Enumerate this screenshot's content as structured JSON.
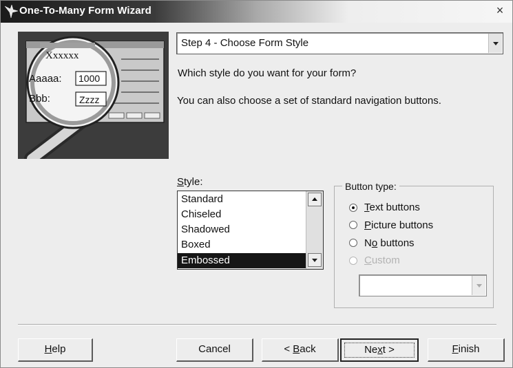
{
  "window": {
    "title": "One-To-Many Form Wizard",
    "close_glyph": "×"
  },
  "illustration": {
    "heading": "Xxxxxx",
    "field1_label": "Aaaaa:",
    "field1_value": "1000",
    "field2_label": "Bbb:",
    "field2_value": "Zzzz"
  },
  "step_select": {
    "value": "Step 4 - Choose Form Style"
  },
  "prompt": {
    "question": "Which style do you want for your form?",
    "hint": "You can also choose a set of standard navigation buttons."
  },
  "style_list": {
    "label": "Style:",
    "label_accel": "S",
    "label_rest": "tyle:",
    "items": [
      "Standard",
      "Chiseled",
      "Shadowed",
      "Boxed",
      "Embossed"
    ],
    "selected": "Embossed"
  },
  "button_type": {
    "label": "Button type:",
    "options": [
      {
        "accel": "T",
        "rest": "ext buttons",
        "checked": true,
        "enabled": true
      },
      {
        "accel": "P",
        "rest": "icture buttons",
        "checked": false,
        "enabled": true
      },
      {
        "pre": "N",
        "accel": "o",
        "rest": " buttons",
        "checked": false,
        "enabled": true
      },
      {
        "accel": "C",
        "rest": "ustom",
        "checked": false,
        "enabled": false
      }
    ],
    "custom_select_value": ""
  },
  "footer": {
    "help": {
      "accel": "H",
      "rest": "elp"
    },
    "cancel": "Cancel",
    "back": {
      "pre": "< ",
      "accel": "B",
      "rest": "ack"
    },
    "next": {
      "pre": "Ne",
      "accel": "x",
      "rest": "t >"
    },
    "finish": {
      "accel": "F",
      "rest": "inish"
    }
  }
}
